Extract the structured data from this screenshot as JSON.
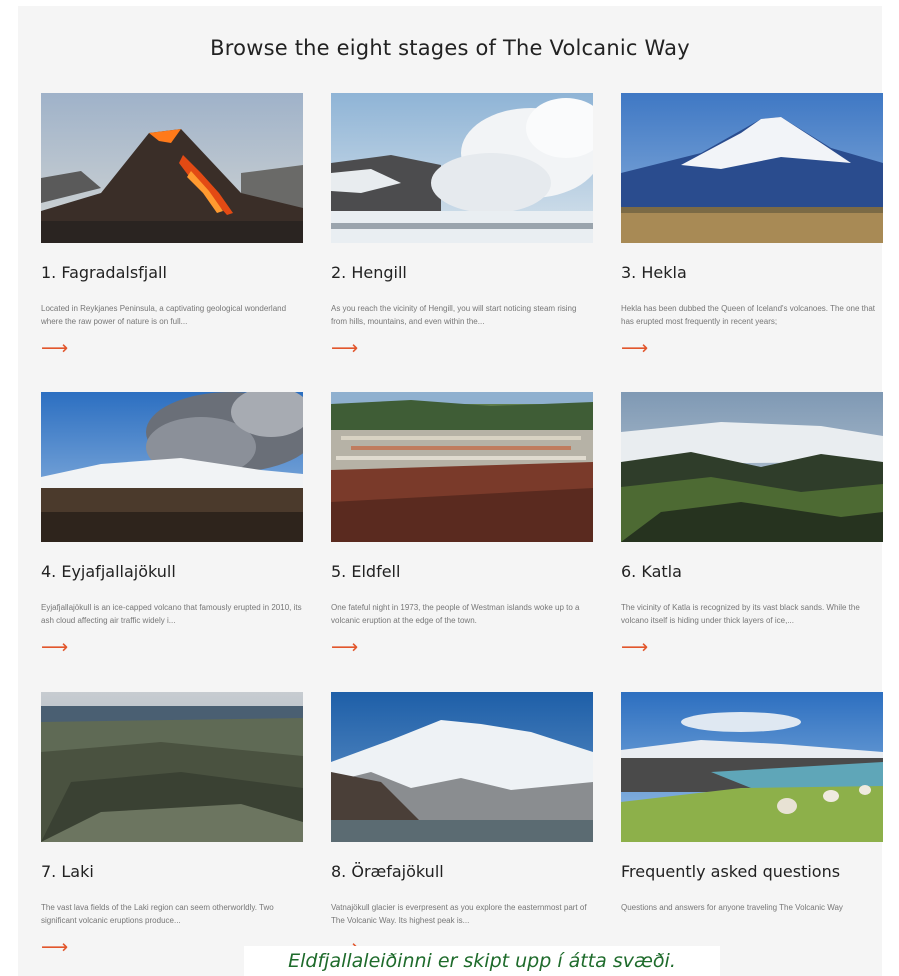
{
  "page": {
    "title": "Browse the eight stages of The Volcanic Way",
    "caption": "Eldfjallaleiðinni er skipt upp í átta svæði."
  },
  "colors": {
    "accent": "#e2562c",
    "caption_text": "#1e6b2b"
  },
  "cards": [
    {
      "title": "1. Fagradalsfjall",
      "desc": "Located in Reykjanes Peninsula, a captivating geological wonderland where the raw power of nature is on full...",
      "arrow": "⟶",
      "image": "erupting-volcano-photo"
    },
    {
      "title": "2. Hengill",
      "desc": "As you reach the vicinity of Hengill, you will start noticing steam rising from hills, mountains, and even within the...",
      "arrow": "⟶",
      "image": "geothermal-steam-photo"
    },
    {
      "title": "3. Hekla",
      "desc": "Hekla has been dubbed the Queen of Iceland's volcanoes. The one that has erupted most frequently in recent years;",
      "arrow": "⟶",
      "image": "snowy-volcano-photo"
    },
    {
      "title": "4. Eyjafjallajökull",
      "desc": "Eyjafjallajökull is an ice-capped volcano that famously erupted in 2010, its ash cloud affecting air traffic widely i...",
      "arrow": "⟶",
      "image": "ash-cloud-photo"
    },
    {
      "title": "5. Eldfell",
      "desc": "One fateful night in 1973, the people of Westman islands woke up to a volcanic eruption at the edge of the town.",
      "arrow": "⟶",
      "image": "town-view-photo"
    },
    {
      "title": "6. Katla",
      "desc": "The vicinity of Katla is recognized by its vast black sands. While the volcano itself is hiding under thick layers of ice,...",
      "arrow": "⟶",
      "image": "glacier-valley-photo"
    },
    {
      "title": "7. Laki",
      "desc": "The vast lava fields of the Laki region can seem otherworldly. Two significant volcanic eruptions produce...",
      "arrow": "⟶",
      "image": "lava-fields-photo"
    },
    {
      "title": "8. Öræfajökull",
      "desc": "Vatnajökull glacier is everpresent as you explore the easternmost part of The Volcanic Way. Its highest peak is...",
      "arrow": "⟶",
      "image": "glacier-mountain-photo"
    },
    {
      "title": "Frequently asked questions",
      "desc": "Questions and answers for anyone traveling The Volcanic Way",
      "arrow": "",
      "image": "sheep-coast-photo"
    }
  ]
}
